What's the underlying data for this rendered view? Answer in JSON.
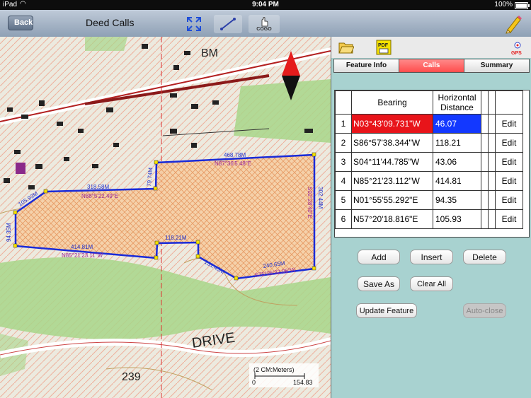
{
  "status": {
    "carrier": "iPad",
    "time": "9:04 PM",
    "battery": "100%"
  },
  "nav": {
    "back_label": "Back",
    "title": "Deed Calls",
    "cogo_label": "COGO"
  },
  "panel": {
    "pdf_label": "PDF",
    "gps_label": "GPS",
    "tabs": [
      "Feature Info",
      "Calls",
      "Summary"
    ],
    "active_tab": "Calls",
    "table": {
      "headers": [
        "Bearing",
        "Horizontal Distance"
      ],
      "rows": [
        {
          "n": "1",
          "bearing": "N03°43'09.731\"W",
          "distance": "46.07",
          "action": "Edit"
        },
        {
          "n": "2",
          "bearing": "S86°57'38.344\"W",
          "distance": "118.21",
          "action": "Edit"
        },
        {
          "n": "3",
          "bearing": "S04°11'44.785\"W",
          "distance": "43.06",
          "action": "Edit"
        },
        {
          "n": "4",
          "bearing": "N85°21'23.112\"W",
          "distance": "414.81",
          "action": "Edit"
        },
        {
          "n": "5",
          "bearing": "N01°55'55.292\"E",
          "distance": "94.35",
          "action": "Edit"
        },
        {
          "n": "6",
          "bearing": "N57°20'18.816\"E",
          "distance": "105.93",
          "action": "Edit"
        }
      ]
    },
    "buttons": {
      "add": "Add",
      "insert": "Insert",
      "delete": "Delete",
      "save_as": "Save As",
      "clear_all": "Clear All",
      "update_feature": "Update Feature",
      "auto_close": "Auto-close"
    }
  },
  "map": {
    "labels": {
      "l1": "468.78M",
      "l2": "N87°36'5.48\"E",
      "l3": "79.74M",
      "l4": "318.58M",
      "l5": "N88°5'22.49\"E",
      "l6": "105.93M",
      "l7": "94.35M",
      "l8": "414.81M",
      "l9": "N85°21'23.11\"W",
      "l10": "118.21M",
      "l11": "131.43M",
      "l12": "240.65M",
      "l13": "S75°25'32.06\"W",
      "l14": "302.44M",
      "l15": "S02°28'40\"E",
      "street": "DRIVE",
      "elev": "239",
      "bm": "BM"
    },
    "scale": {
      "title": "(2 CM:Meters)",
      "min": "0",
      "max": "154.83"
    },
    "colors": {
      "boundary": "#1a2bd8",
      "fill": "#f3a56a",
      "vertex": "#f5e100"
    }
  }
}
